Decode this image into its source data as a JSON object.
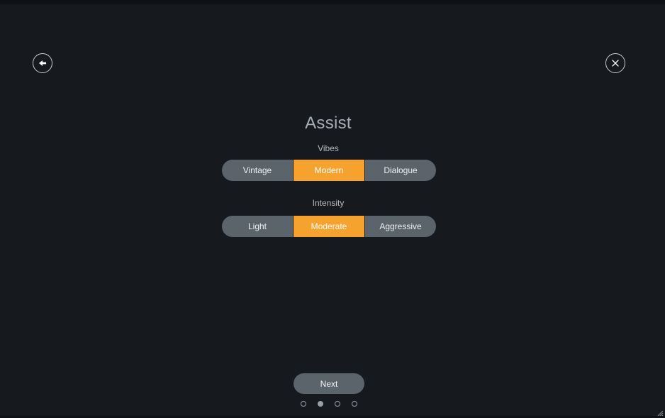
{
  "header": {
    "back_icon": "back-arrow-icon",
    "close_icon": "close-icon"
  },
  "main": {
    "title": "Assist",
    "vibes": {
      "label": "Vibes",
      "options": [
        "Vintage",
        "Modern",
        "Dialogue"
      ],
      "selected": "Modern"
    },
    "intensity": {
      "label": "Intensity",
      "options": [
        "Light",
        "Moderate",
        "Aggressive"
      ],
      "selected": "Moderate"
    }
  },
  "footer": {
    "next_label": "Next",
    "pagination": {
      "total": 4,
      "current": 2
    }
  },
  "colors": {
    "background": "#16191d",
    "accent": "#f5a32e",
    "segment": "#5b636b"
  }
}
